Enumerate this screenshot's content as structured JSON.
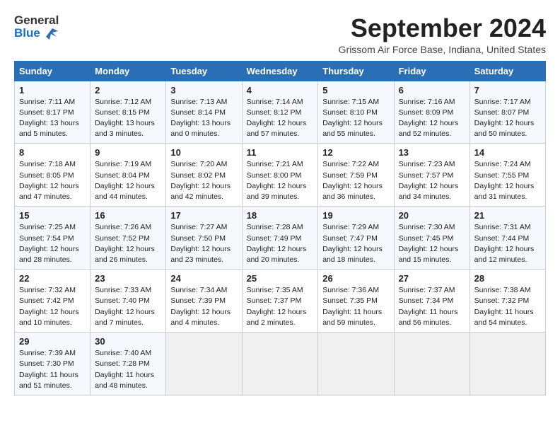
{
  "header": {
    "logo_general": "General",
    "logo_blue": "Blue",
    "title": "September 2024",
    "subtitle": "Grissom Air Force Base, Indiana, United States"
  },
  "days_of_week": [
    "Sunday",
    "Monday",
    "Tuesday",
    "Wednesday",
    "Thursday",
    "Friday",
    "Saturday"
  ],
  "weeks": [
    [
      {
        "day": "1",
        "info": "Sunrise: 7:11 AM\nSunset: 8:17 PM\nDaylight: 13 hours\nand 5 minutes."
      },
      {
        "day": "2",
        "info": "Sunrise: 7:12 AM\nSunset: 8:15 PM\nDaylight: 13 hours\nand 3 minutes."
      },
      {
        "day": "3",
        "info": "Sunrise: 7:13 AM\nSunset: 8:14 PM\nDaylight: 13 hours\nand 0 minutes."
      },
      {
        "day": "4",
        "info": "Sunrise: 7:14 AM\nSunset: 8:12 PM\nDaylight: 12 hours\nand 57 minutes."
      },
      {
        "day": "5",
        "info": "Sunrise: 7:15 AM\nSunset: 8:10 PM\nDaylight: 12 hours\nand 55 minutes."
      },
      {
        "day": "6",
        "info": "Sunrise: 7:16 AM\nSunset: 8:09 PM\nDaylight: 12 hours\nand 52 minutes."
      },
      {
        "day": "7",
        "info": "Sunrise: 7:17 AM\nSunset: 8:07 PM\nDaylight: 12 hours\nand 50 minutes."
      }
    ],
    [
      {
        "day": "8",
        "info": "Sunrise: 7:18 AM\nSunset: 8:05 PM\nDaylight: 12 hours\nand 47 minutes."
      },
      {
        "day": "9",
        "info": "Sunrise: 7:19 AM\nSunset: 8:04 PM\nDaylight: 12 hours\nand 44 minutes."
      },
      {
        "day": "10",
        "info": "Sunrise: 7:20 AM\nSunset: 8:02 PM\nDaylight: 12 hours\nand 42 minutes."
      },
      {
        "day": "11",
        "info": "Sunrise: 7:21 AM\nSunset: 8:00 PM\nDaylight: 12 hours\nand 39 minutes."
      },
      {
        "day": "12",
        "info": "Sunrise: 7:22 AM\nSunset: 7:59 PM\nDaylight: 12 hours\nand 36 minutes."
      },
      {
        "day": "13",
        "info": "Sunrise: 7:23 AM\nSunset: 7:57 PM\nDaylight: 12 hours\nand 34 minutes."
      },
      {
        "day": "14",
        "info": "Sunrise: 7:24 AM\nSunset: 7:55 PM\nDaylight: 12 hours\nand 31 minutes."
      }
    ],
    [
      {
        "day": "15",
        "info": "Sunrise: 7:25 AM\nSunset: 7:54 PM\nDaylight: 12 hours\nand 28 minutes."
      },
      {
        "day": "16",
        "info": "Sunrise: 7:26 AM\nSunset: 7:52 PM\nDaylight: 12 hours\nand 26 minutes."
      },
      {
        "day": "17",
        "info": "Sunrise: 7:27 AM\nSunset: 7:50 PM\nDaylight: 12 hours\nand 23 minutes."
      },
      {
        "day": "18",
        "info": "Sunrise: 7:28 AM\nSunset: 7:49 PM\nDaylight: 12 hours\nand 20 minutes."
      },
      {
        "day": "19",
        "info": "Sunrise: 7:29 AM\nSunset: 7:47 PM\nDaylight: 12 hours\nand 18 minutes."
      },
      {
        "day": "20",
        "info": "Sunrise: 7:30 AM\nSunset: 7:45 PM\nDaylight: 12 hours\nand 15 minutes."
      },
      {
        "day": "21",
        "info": "Sunrise: 7:31 AM\nSunset: 7:44 PM\nDaylight: 12 hours\nand 12 minutes."
      }
    ],
    [
      {
        "day": "22",
        "info": "Sunrise: 7:32 AM\nSunset: 7:42 PM\nDaylight: 12 hours\nand 10 minutes."
      },
      {
        "day": "23",
        "info": "Sunrise: 7:33 AM\nSunset: 7:40 PM\nDaylight: 12 hours\nand 7 minutes."
      },
      {
        "day": "24",
        "info": "Sunrise: 7:34 AM\nSunset: 7:39 PM\nDaylight: 12 hours\nand 4 minutes."
      },
      {
        "day": "25",
        "info": "Sunrise: 7:35 AM\nSunset: 7:37 PM\nDaylight: 12 hours\nand 2 minutes."
      },
      {
        "day": "26",
        "info": "Sunrise: 7:36 AM\nSunset: 7:35 PM\nDaylight: 11 hours\nand 59 minutes."
      },
      {
        "day": "27",
        "info": "Sunrise: 7:37 AM\nSunset: 7:34 PM\nDaylight: 11 hours\nand 56 minutes."
      },
      {
        "day": "28",
        "info": "Sunrise: 7:38 AM\nSunset: 7:32 PM\nDaylight: 11 hours\nand 54 minutes."
      }
    ],
    [
      {
        "day": "29",
        "info": "Sunrise: 7:39 AM\nSunset: 7:30 PM\nDaylight: 11 hours\nand 51 minutes."
      },
      {
        "day": "30",
        "info": "Sunrise: 7:40 AM\nSunset: 7:28 PM\nDaylight: 11 hours\nand 48 minutes."
      },
      {
        "day": "",
        "info": ""
      },
      {
        "day": "",
        "info": ""
      },
      {
        "day": "",
        "info": ""
      },
      {
        "day": "",
        "info": ""
      },
      {
        "day": "",
        "info": ""
      }
    ]
  ]
}
